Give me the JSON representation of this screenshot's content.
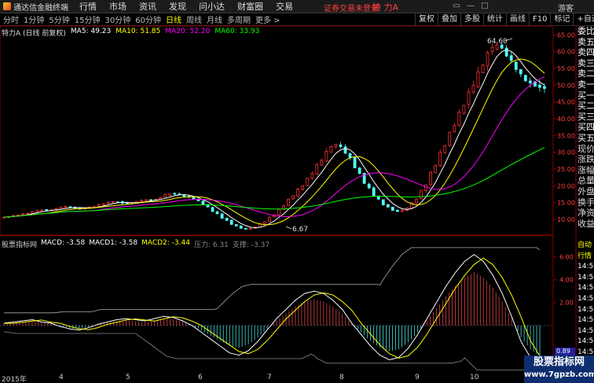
{
  "menubar": {
    "app_title": "通达信金融终端",
    "items": [
      "行情",
      "市场",
      "资讯",
      "发现",
      "问小达",
      "财富圈",
      "交易"
    ],
    "notice": "证券交易未登录",
    "stock_name": "特 力A",
    "guest": "游客"
  },
  "toolbar": {
    "periods": [
      "分时",
      "1分钟",
      "5分钟",
      "15分钟",
      "30分钟",
      "60分钟",
      "日线",
      "周线",
      "月线",
      "多周期",
      "更多 >"
    ],
    "active_period": "日线",
    "right_tools": [
      "复权",
      "叠加",
      "多股",
      "统计",
      "画线",
      "F10",
      "标记",
      "+自选"
    ]
  },
  "main_chart": {
    "title": "特力A (日线 前复权)",
    "ma": [
      {
        "label": "MA5: 49.23",
        "color": "#ffffff"
      },
      {
        "label": "MA10: 51.85",
        "color": "#ffff00"
      },
      {
        "label": "MA20: 52.20",
        "color": "#ff00ff"
      },
      {
        "label": "MA60: 33.93",
        "color": "#00ff00"
      }
    ],
    "high_label": "64.60",
    "low_label": "6.67",
    "y_ticks": [
      "65.00",
      "60.00",
      "55.00",
      "50.00",
      "45.00",
      "40.00",
      "35.00",
      "30.00",
      "25.00",
      "20.00",
      "15.00",
      "10.00"
    ]
  },
  "macd": {
    "source": "股票指标网",
    "macd": "MACD: -3.58",
    "macd1": "MACD1: -3.58",
    "macd2": "MACD2: -3.44",
    "pressure": "压力: 6.31",
    "support": "支撑: -3.37",
    "y_ticks": [
      "6.00",
      "4.00",
      "2.00"
    ],
    "current": "0.89"
  },
  "right_panel": {
    "items": [
      "委比",
      "卖五",
      "卖四",
      "卖三",
      "卖二",
      "卖一",
      "买一",
      "买二",
      "买三",
      "买四",
      "买五",
      "现价",
      "涨跌",
      "涨幅",
      "总量",
      "外盘",
      "换手",
      "净资",
      "收益"
    ],
    "lower_items": [
      "自动",
      "行情",
      "14:50",
      "14:50",
      "14:50",
      "14:50",
      "14:50",
      "14:50",
      "14:50",
      "14:50",
      "14:50",
      "14:50"
    ]
  },
  "date_axis": [
    "2015年",
    "4",
    "5",
    "6",
    "7",
    "8",
    "9",
    "10"
  ],
  "watermark": {
    "title": "股票指标网",
    "url": "www.7gpzb.com"
  },
  "chart_data": {
    "type": "candlestick",
    "series": [
      {
        "name": "MA5",
        "color": "#ffffff"
      },
      {
        "name": "MA10",
        "color": "#ffff00"
      },
      {
        "name": "MA20",
        "color": "#ff00ff"
      },
      {
        "name": "MA60",
        "color": "#00ff00"
      }
    ],
    "price_range": [
      6,
      66
    ],
    "peak": 64.6,
    "trough": 6.67,
    "close_path": [
      10.5,
      11,
      11.5,
      12,
      13,
      12.5,
      13.5,
      14,
      13,
      13.5,
      14,
      15,
      15.5,
      14.5,
      15,
      16,
      15.5,
      17,
      18,
      17,
      16.5,
      15,
      13,
      11,
      9,
      7.5,
      7,
      8,
      10,
      12,
      15,
      18,
      21,
      25,
      29,
      33,
      31,
      27,
      22,
      18,
      15,
      13,
      12,
      14,
      17,
      22,
      28,
      34,
      40,
      46,
      52,
      58,
      63,
      60,
      56,
      52,
      50,
      49
    ],
    "macd_bars": [
      0.2,
      0.3,
      0.4,
      0.5,
      0.3,
      0.2,
      -0.1,
      -0.3,
      -0.4,
      -0.2,
      0.1,
      0.3,
      0.5,
      0.6,
      0.5,
      0.4,
      0.6,
      0.8,
      0.7,
      0.4,
      0,
      -0.6,
      -1.2,
      -1.8,
      -2.4,
      -2.6,
      -2.2,
      -1.4,
      -0.4,
      0.6,
      1.4,
      2.2,
      2.8,
      3.0,
      2.8,
      2.2,
      1.4,
      0.2,
      -0.8,
      -1.8,
      -2.6,
      -3.0,
      -2.8,
      -2.0,
      -0.8,
      0.6,
      2.0,
      3.4,
      4.6,
      5.6,
      6.2,
      5.6,
      4.4,
      2.8,
      0.8,
      -1.4,
      -2.8,
      -3.6
    ],
    "macd_range": [
      -4,
      7
    ]
  }
}
